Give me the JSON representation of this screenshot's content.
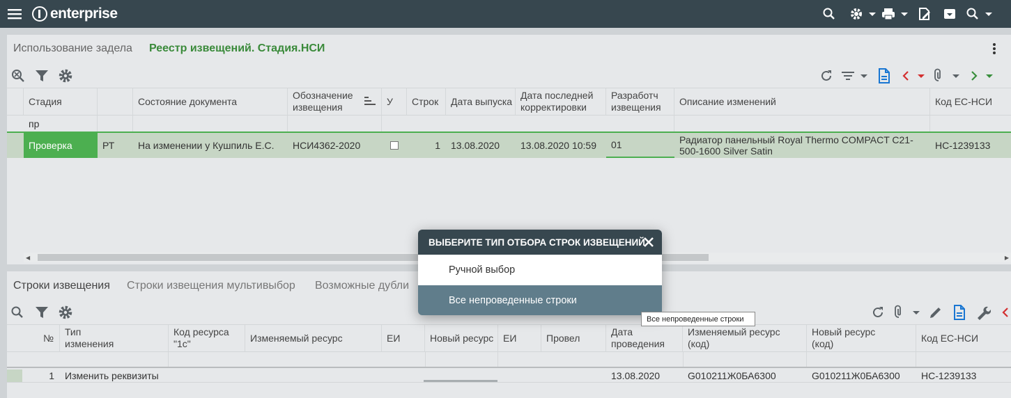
{
  "topbar": {
    "logo_text": "enterprise",
    "icons": [
      "menu-icon",
      "search-icon",
      "gear-icon",
      "print-icon",
      "edit-doc-icon",
      "archive-icon",
      "search-menu-icon"
    ]
  },
  "upper": {
    "title": "Использование задела",
    "subtitle": "Реестр извещений. Стадия.НСИ",
    "columns": [
      "Стадия",
      "",
      "Состояние документа",
      "Обозначение извещения",
      "У",
      "Строк",
      "Дата выпуска",
      "Дата последней корректировки",
      "Разработч извещения",
      "Описание изменений",
      "Код ЕС-НСИ"
    ],
    "filter_value": "пр",
    "row": {
      "stage": "Проверка",
      "code": "РТ",
      "state": "На изменении у  Кушпиль Е.С.",
      "number": "НСИ4362-2020",
      "rows": "1",
      "issue_date": "13.08.2020",
      "last_edit": "13.08.2020 10:59",
      "developer": "01",
      "description": "Радиатор панельный Royal Thermo COMPACT C21-500-1600 Silver Satin",
      "nsi_code": "НС-1239133"
    }
  },
  "lower": {
    "tabs": [
      "Строки извещения",
      "Строки извещения мультивыбор",
      "Возможные дубли"
    ],
    "columns": [
      "№",
      "Тип изменения",
      "Код ресурса \"1с\"",
      "Изменяемый ресурс",
      "ЕИ",
      "Новый ресурс",
      "ЕИ",
      "Провел",
      "Дата проведения",
      "Изменяемый ресурс (код)",
      "Новый ресурс (код)",
      "Код ЕС-НСИ"
    ],
    "row": {
      "num": "1",
      "type": "Изменить реквизиты",
      "date": "13.08.2020",
      "old_code": "G010211Ж0БА6300",
      "new_code": "G010211Ж0БА6300",
      "nsi_code": "НС-1239133"
    }
  },
  "modal": {
    "title": "ВЫБЕРИТЕ ТИП ОТБОРА СТРОК ИЗВЕЩЕНИЙ",
    "options": [
      "Ручной выбор",
      "Все непроведенные строки"
    ],
    "tooltip": "Все непроведенные строки"
  },
  "colors": {
    "topbar": "#37474f",
    "accent_green": "#3a8a3a",
    "stage_green": "#4caf50",
    "selected_row": "#c7d6c5",
    "modal_highlight": "#607d8b"
  }
}
